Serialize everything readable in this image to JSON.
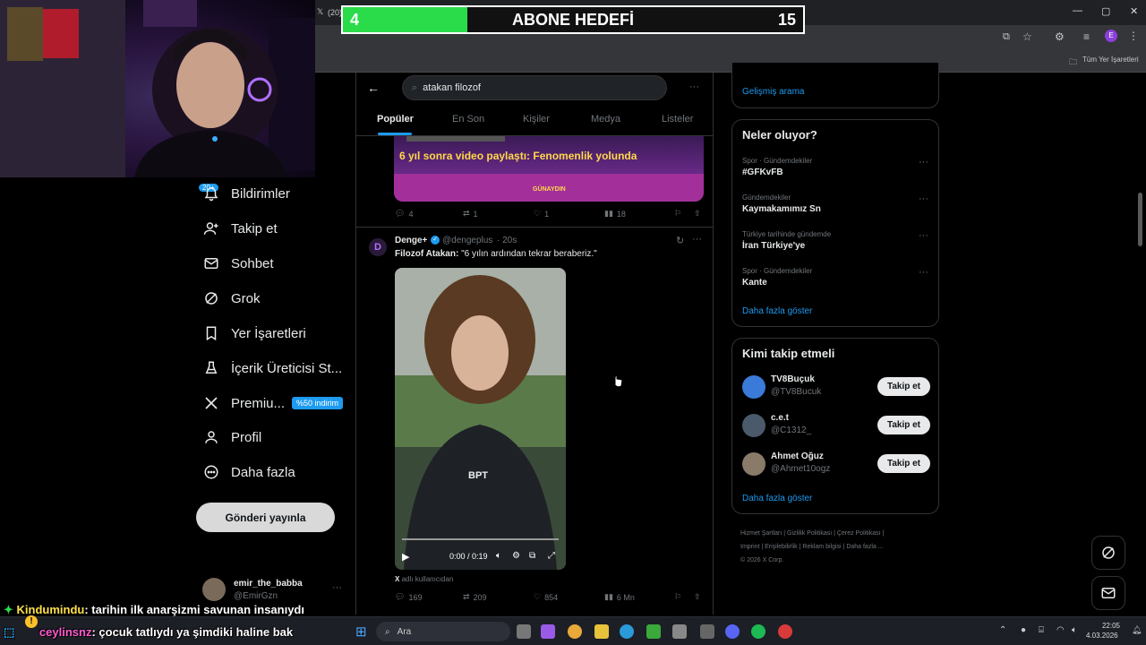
{
  "goal": {
    "title": "ABONE HEDEFİ",
    "current": "4",
    "target": "15",
    "progress": 0.27
  },
  "browser": {
    "tab_count": "(20)",
    "bookmark_all": "Tüm Yer İşaretleri"
  },
  "nav": {
    "notif_badge": "20+",
    "items": [
      "Bildirimler",
      "Takip et",
      "Sohbet",
      "Grok",
      "Yer İşaretleri",
      "İçerik Üreticisi St...",
      "Premiu...",
      "Profil",
      "Daha fazla"
    ],
    "premium_badge": "%50 indirim",
    "post_button": "Gönderi yayınla",
    "user": {
      "name": "emir_the_babba",
      "handle": "@EmirGzn"
    }
  },
  "search": {
    "query": "atakan filozof",
    "tabs": [
      "Popüler",
      "En Son",
      "Kişiler",
      "Medya",
      "Listeler"
    ]
  },
  "tweet1": {
    "banner_text": "6 yıl sonra video paylaştı: Fenomenlik yolunda",
    "banner_brand": "GÜNAYDIN",
    "replies": "4",
    "retweets": "1",
    "likes": "1",
    "views": "18"
  },
  "tweet2": {
    "name": "Denge+",
    "handle": "@dengeplus",
    "time": "· 20s",
    "text_bold": "Filozof Atakan:",
    "text": "\"6 yılın ardından tekrar beraberiz.\"",
    "video_time": "0:00 / 0:19",
    "video_watermark": "BPT",
    "source": "adlı kullanıcıdan",
    "replies": "169",
    "retweets": "209",
    "likes": "854",
    "views": "6 Mn"
  },
  "right": {
    "advanced_search": "Gelişmiş arama",
    "trends_title": "Neler oluyor?",
    "trends": [
      {
        "meta": "Spor · Gündemdekiler",
        "name": "#GFKvFB"
      },
      {
        "meta": "Gündemdekiler",
        "name": "Kaymakamımız Sn"
      },
      {
        "meta": "Türkiye tarihinde gündemde",
        "name": "İran Türkiye'ye"
      },
      {
        "meta": "Spor · Gündemdekiler",
        "name": "Kante"
      }
    ],
    "show_more": "Daha fazla göster",
    "who_title": "Kimi takip etmeli",
    "who": [
      {
        "name": "TV8Buçuk",
        "handle": "@TV8Bucuk",
        "btn": "Takip et"
      },
      {
        "name": "c.e.t",
        "handle": "@C1312_",
        "btn": "Takip et"
      },
      {
        "name": "Ahmet Oğuz",
        "handle": "@Ahmet10ogz",
        "btn": "Takip et"
      }
    ],
    "who_more": "Daha fazla göster",
    "footer": [
      "Hizmet Şartları",
      "Gizlilik Politikası",
      "Çerez Politikası",
      "Imprint",
      "Erişilebilirlik",
      "Reklam bilgisi",
      "Daha fazla ...",
      "© 2026 X Corp."
    ]
  },
  "chat": [
    {
      "user": "Kindumindu",
      "msg": ": tarihin ilk anarşizmi savunan insanıydı"
    },
    {
      "user": "ceylinsnz",
      "msg": ": çocuk tatlıydı ya şimdiki haline bak"
    }
  ],
  "taskbar": {
    "search": "Ara",
    "time": "22:05",
    "date": "4.03.2026"
  }
}
